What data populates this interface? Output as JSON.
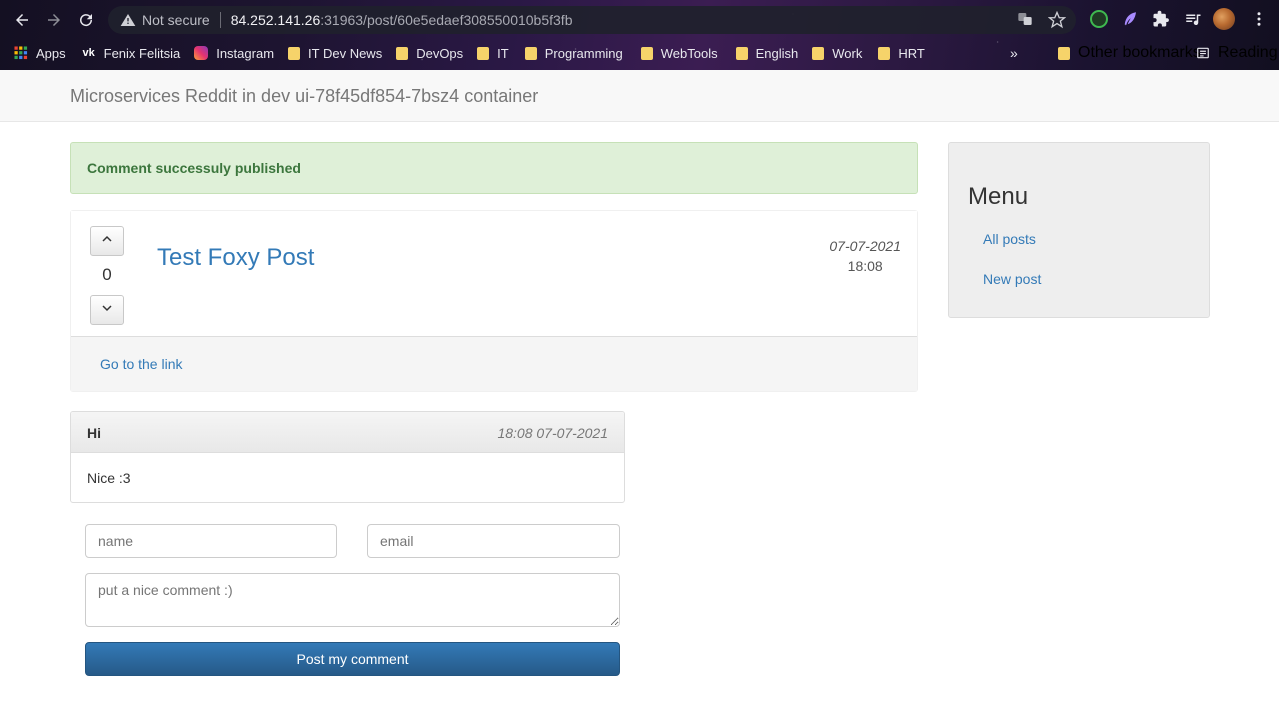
{
  "browser": {
    "security_label": "Not secure",
    "url_host": "84.252.141.26",
    "url_path": ":31963/post/60e5edaef308550010b5f3fb",
    "bookmarks": [
      {
        "label": "Apps",
        "icon": "apps-grid-icon"
      },
      {
        "label": "Fenix Felitsia",
        "icon": "vk-icon"
      },
      {
        "label": "Instagram",
        "icon": "instagram-icon"
      },
      {
        "label": "IT Dev News",
        "icon": "folder-icon"
      },
      {
        "label": "DevOps",
        "icon": "folder-icon"
      },
      {
        "label": "IT",
        "icon": "folder-icon"
      },
      {
        "label": "Programming",
        "icon": "folder-icon"
      },
      {
        "label": "WebTools",
        "icon": "folder-icon"
      },
      {
        "label": "English",
        "icon": "folder-icon"
      },
      {
        "label": "Work",
        "icon": "folder-icon"
      },
      {
        "label": "HRT",
        "icon": "folder-icon"
      }
    ],
    "more_bookmarks": "»",
    "other_bookmarks": "Other bookmarks",
    "reading_list": "Reading list"
  },
  "page": {
    "brand": "Microservices Reddit in dev ui-78f45df854-7bsz4 container",
    "alert": "Comment successuly published",
    "post": {
      "vote_count": "0",
      "title": "Test Foxy Post",
      "date": "07-07-2021",
      "time": "18:08",
      "link_label": "Go to the link"
    },
    "comment": {
      "author": "Hi",
      "timestamp": "18:08 07-07-2021",
      "body": "Nice :3"
    },
    "form": {
      "name_placeholder": "name",
      "email_placeholder": "email",
      "comment_placeholder": "put a nice comment :)",
      "submit_label": "Post my comment"
    },
    "menu": {
      "title": "Menu",
      "items": [
        "All posts",
        "New post"
      ]
    }
  },
  "colors": {
    "link": "#337ab7",
    "alert_bg": "#dff0d8",
    "alert_text": "#3c763d",
    "button": "#2e6da4"
  }
}
